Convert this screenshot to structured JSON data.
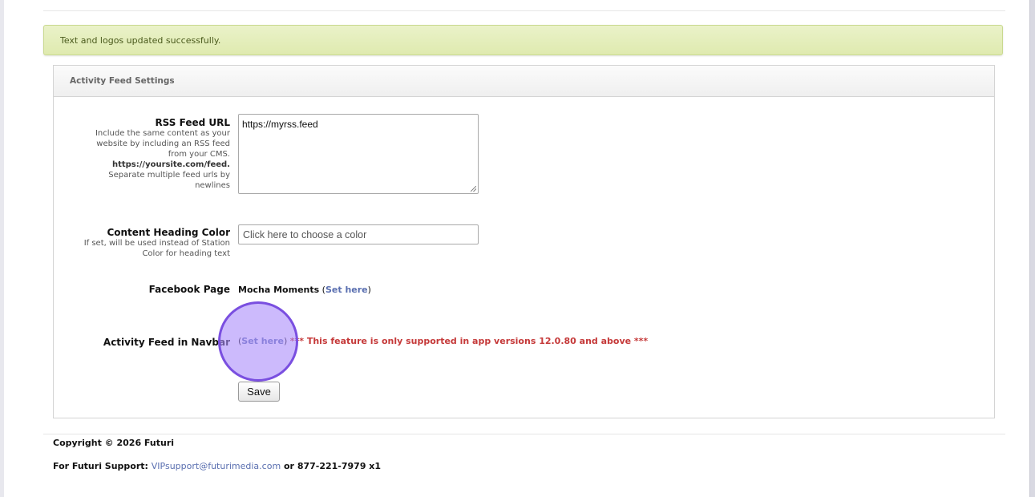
{
  "alert": {
    "message": "Text and logos updated successfully."
  },
  "panel": {
    "title": "Activity Feed Settings"
  },
  "rss": {
    "label": "RSS Feed URL",
    "help_lines": [
      "Include the same content as your",
      "website by including an RSS feed",
      "from your CMS.",
      "https://yoursite.com/feed.",
      "Separate multiple feed urls by",
      "newlines"
    ],
    "value": "https://myrss.feed"
  },
  "heading_color": {
    "label": "Content Heading Color",
    "help_lines": [
      "If set, will be used instead of Station",
      "Color for heading text"
    ],
    "placeholder": "Click here to choose a color"
  },
  "facebook": {
    "label": "Facebook Page",
    "page_name": "Mocha Moments",
    "open_paren": " (",
    "link_text": "Set here",
    "close_paren": ")"
  },
  "navbar": {
    "label": "Activity Feed in Navbar",
    "open_paren": "(",
    "link_text": "Set here",
    "close_paren": ") ",
    "warning": "*** This feature is only supported in app versions 12.0.80 and above ***"
  },
  "save_button": {
    "label": "Save"
  },
  "footer": {
    "copyright": "Copyright © 2026 Futuri",
    "support_prefix": "For Futuri Support: ",
    "support_email": "VIPsupport@futurimedia.com",
    "support_suffix": " or 877-221-7979 x1"
  },
  "colors": {
    "link": "#5a6fb0",
    "warning": "#c53939",
    "alert_bg": "#e4edbd",
    "click_marker": "#a98cfa"
  }
}
